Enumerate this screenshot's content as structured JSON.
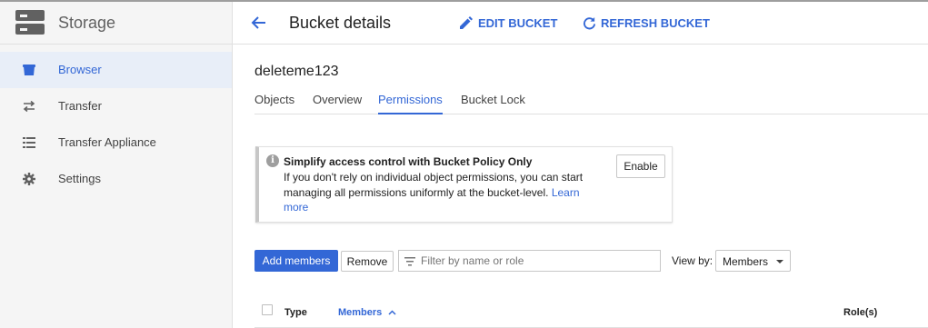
{
  "app": {
    "title": "Storage"
  },
  "sidebar": {
    "items": [
      {
        "label": "Browser",
        "icon": "bucket-icon",
        "active": true
      },
      {
        "label": "Transfer",
        "icon": "transfer-arrows-icon",
        "active": false
      },
      {
        "label": "Transfer Appliance",
        "icon": "list-icon",
        "active": false
      },
      {
        "label": "Settings",
        "icon": "gear-icon",
        "active": false
      }
    ]
  },
  "header": {
    "title": "Bucket details",
    "edit_label": "EDIT BUCKET",
    "refresh_label": "REFRESH BUCKET"
  },
  "bucket": {
    "name": "deleteme123"
  },
  "tabs": [
    {
      "label": "Objects",
      "active": false
    },
    {
      "label": "Overview",
      "active": false
    },
    {
      "label": "Permissions",
      "active": true
    },
    {
      "label": "Bucket Lock",
      "active": false
    }
  ],
  "notice": {
    "title": "Simplify access control with Bucket Policy Only",
    "text": "If you don't rely on individual object permissions, you can start managing all permissions uniformly at the bucket-level.",
    "link": "Learn more",
    "enable_label": "Enable"
  },
  "toolbar": {
    "add_label": "Add members",
    "remove_label": "Remove",
    "filter_placeholder": "Filter by name or role",
    "filter_value": "",
    "viewby_label": "View by:",
    "viewby_value": "Members"
  },
  "table": {
    "columns": [
      "Type",
      "Members",
      "Role(s)"
    ],
    "sorted_column": "Members",
    "sort_direction": "ascending"
  },
  "colors": {
    "accent": "#3367d6",
    "sidebar_bg": "#f5f5f5",
    "active_item_bg": "#e8eef8"
  }
}
